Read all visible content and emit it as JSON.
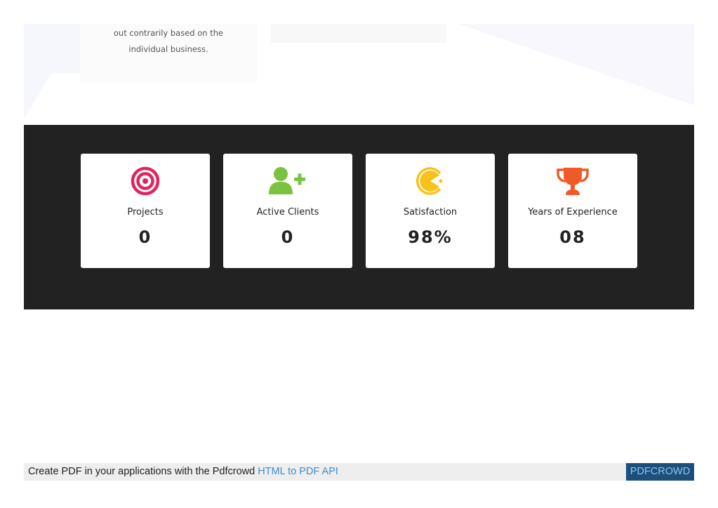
{
  "top_section": {
    "card_text_line1": "out contrarily based on the",
    "card_text_line2": "individual business."
  },
  "stats": [
    {
      "label": "Projects",
      "value": "0",
      "icon": "target-icon",
      "color": "#e0245e"
    },
    {
      "label": "Active Clients",
      "value": "0",
      "icon": "user-plus-icon",
      "color": "#7cc242"
    },
    {
      "label": "Satisfaction",
      "value": "98%",
      "icon": "pacman-icon",
      "color": "#f7c21a"
    },
    {
      "label": "Years of Experience",
      "value": "08",
      "icon": "trophy-icon",
      "color": "#f05a28"
    }
  ],
  "colors": {
    "dark_band": "#222222",
    "footer_bg": "#eeeeee",
    "badge_bg": "#1d4f7c",
    "link": "#3b8ed0"
  },
  "footer": {
    "text": "Create PDF in your applications with the Pdfcrowd",
    "link_text": "HTML to PDF API",
    "badge": "PDFCROWD"
  }
}
